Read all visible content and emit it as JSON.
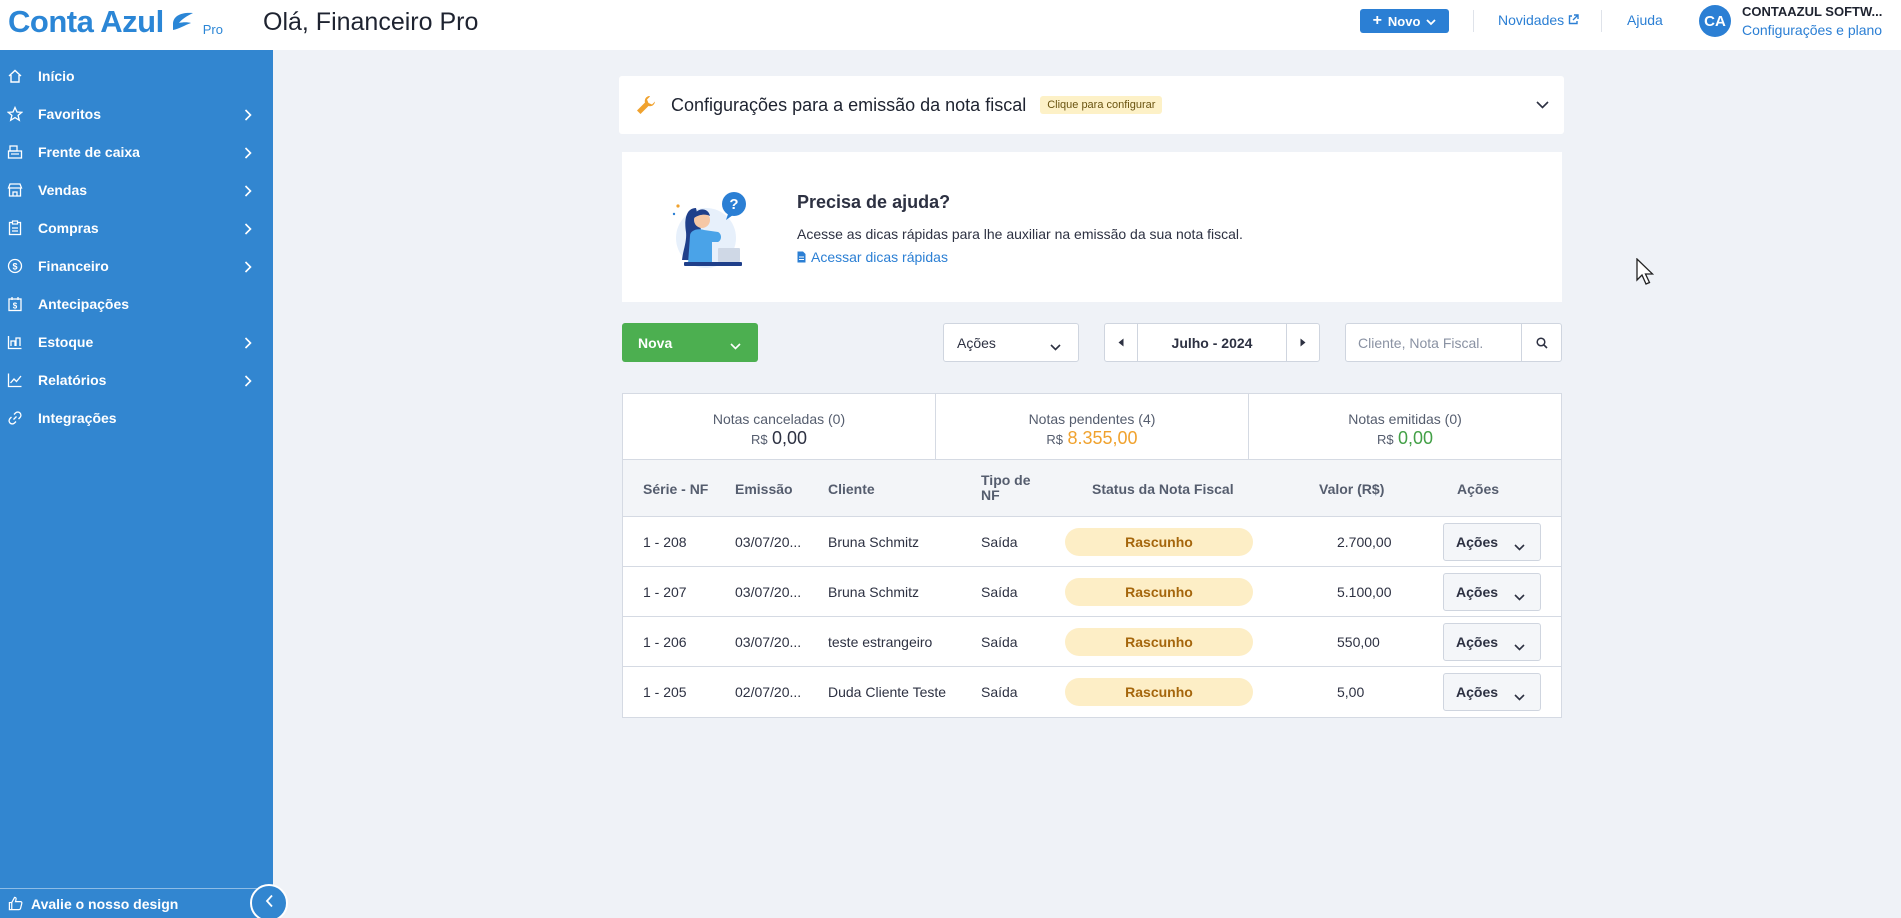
{
  "header": {
    "logo_text": "Conta Azul",
    "logo_badge": "Pro",
    "greeting": "Olá, Financeiro Pro",
    "new_button_label": "Novo",
    "novidades_label": "Novidades",
    "ajuda_label": "Ajuda",
    "avatar_initials": "CA",
    "account_name": "CONTAAZUL SOFTW...",
    "account_plan_label": "Configurações e plano"
  },
  "sidebar": {
    "items": [
      {
        "label": "Início",
        "icon": "home-icon"
      },
      {
        "label": "Favoritos",
        "icon": "star-icon"
      },
      {
        "label": "Frente de caixa",
        "icon": "cash-register-icon"
      },
      {
        "label": "Vendas",
        "icon": "store-icon"
      },
      {
        "label": "Compras",
        "icon": "clipboard-icon"
      },
      {
        "label": "Financeiro",
        "icon": "dollar-circle-icon"
      },
      {
        "label": "Antecipações",
        "icon": "calendar-dollar-icon"
      },
      {
        "label": "Estoque",
        "icon": "inventory-icon"
      },
      {
        "label": "Relatórios",
        "icon": "chart-line-icon"
      },
      {
        "label": "Integrações",
        "icon": "link-icon"
      }
    ],
    "feedback_label": "Avalie o nosso design"
  },
  "config": {
    "title": "Configurações para a emissão da nota fiscal",
    "badge": "Clique para configurar"
  },
  "help": {
    "title": "Precisa de ajuda?",
    "description": "Acesse as dicas rápidas para lhe auxiliar na emissão da sua nota fiscal.",
    "link_label": "Acessar dicas rápidas"
  },
  "toolbar": {
    "new_label": "Nova",
    "actions_label": "Ações",
    "month_label": "Julho - 2024",
    "search_placeholder": "Cliente, Nota Fiscal."
  },
  "summary": [
    {
      "label": "Notas canceladas (0)",
      "currency": "R$",
      "value": "0,00",
      "color": "#2d3142"
    },
    {
      "label": "Notas pendentes (4)",
      "currency": "R$",
      "value": "8.355,00",
      "color": "#f0a22e"
    },
    {
      "label": "Notas emitidas (0)",
      "currency": "R$",
      "value": "0,00",
      "color": "#43a047"
    }
  ],
  "table": {
    "columns": [
      "Série - NF",
      "Emissão",
      "Cliente",
      "Tipo de NF",
      "Status da Nota Fiscal",
      "Valor (R$)",
      "Ações"
    ],
    "rows": [
      {
        "serie": "1 - 208",
        "emissao": "03/07/20...",
        "cliente": "Bruna Schmitz",
        "tipo": "Saída",
        "status": "Rascunho",
        "valor": "2.700,00",
        "acoes": "Ações"
      },
      {
        "serie": "1 - 207",
        "emissao": "03/07/20...",
        "cliente": "Bruna Schmitz",
        "tipo": "Saída",
        "status": "Rascunho",
        "valor": "5.100,00",
        "acoes": "Ações"
      },
      {
        "serie": "1 - 206",
        "emissao": "03/07/20...",
        "cliente": "teste estrangeiro",
        "tipo": "Saída",
        "status": "Rascunho",
        "valor": "550,00",
        "acoes": "Ações"
      },
      {
        "serie": "1 - 205",
        "emissao": "02/07/20...",
        "cliente": "Duda Cliente Teste",
        "tipo": "Saída",
        "status": "Rascunho",
        "valor": "5,00",
        "acoes": "Ações"
      }
    ]
  },
  "colors": {
    "brand_blue": "#3286d0",
    "primary_button": "#2b7fd4",
    "success_green": "#4caf50",
    "draft_badge_bg": "#fdeec6",
    "draft_badge_text": "#a5660c"
  }
}
